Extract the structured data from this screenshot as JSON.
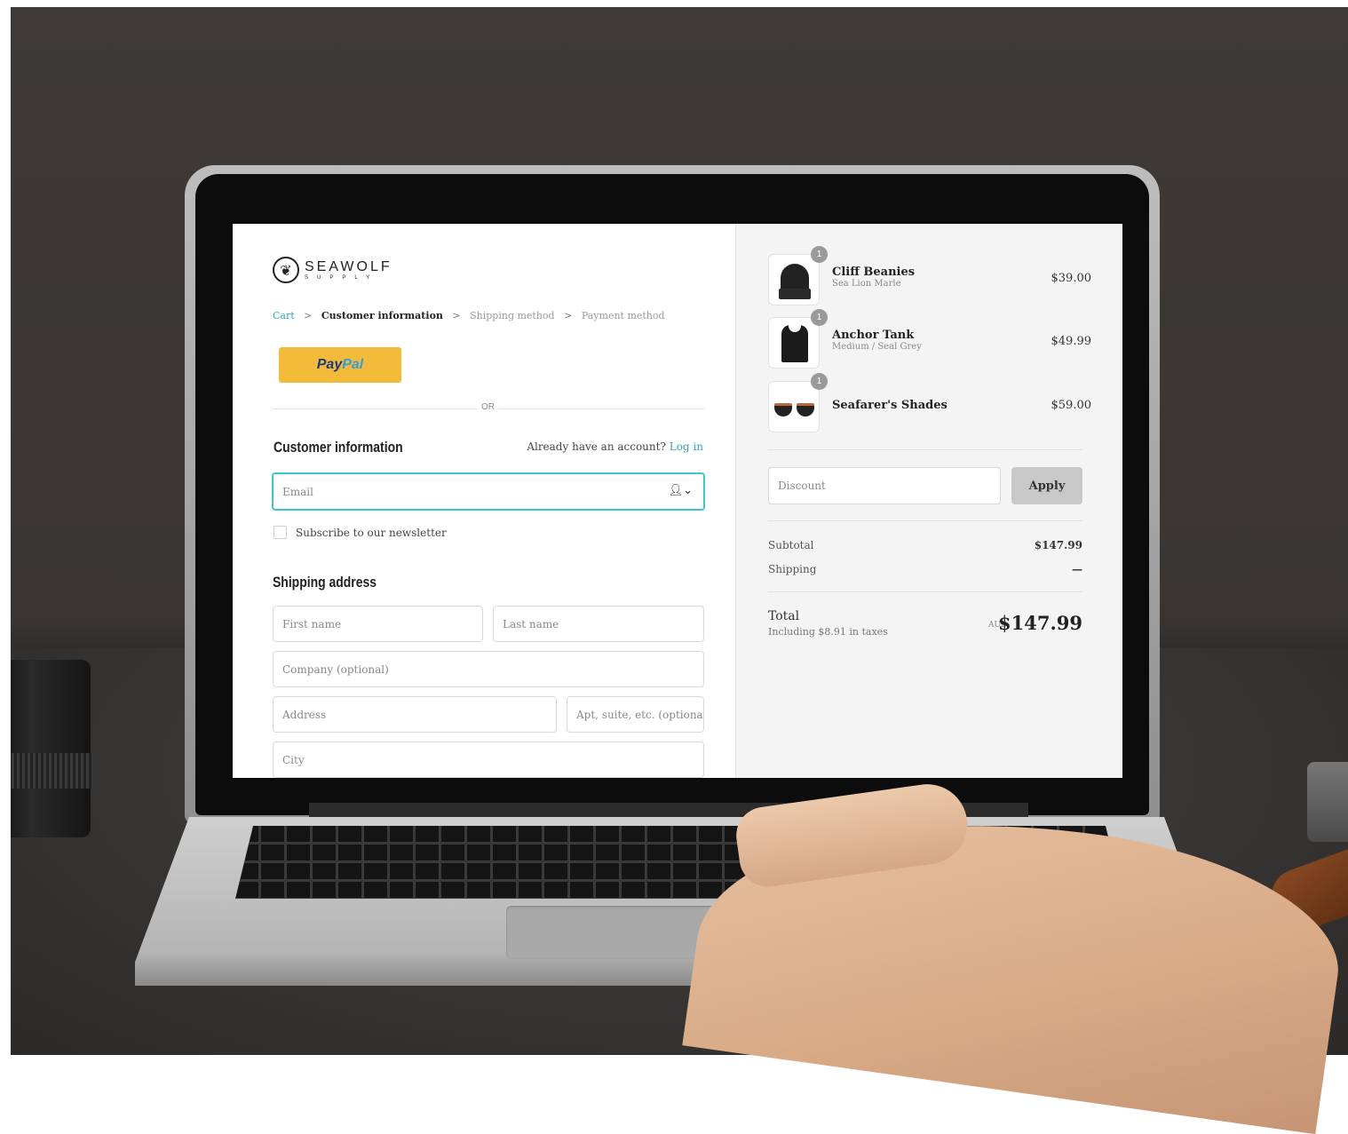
{
  "brand": {
    "name": "SEAWOLF",
    "sub": "SUPPLY"
  },
  "breadcrumb": {
    "cart": "Cart",
    "customer_information": "Customer information",
    "shipping_method": "Shipping method",
    "payment_method": "Payment method",
    "separator": ">"
  },
  "paypal": {
    "part1": "Pay",
    "part2": "Pal"
  },
  "or_label": "OR",
  "customer": {
    "title": "Customer information",
    "account_prompt": "Already have an account?",
    "login_link": "Log in",
    "email_placeholder": "Email",
    "newsletter_label": "Subscribe to our newsletter"
  },
  "shipping": {
    "title": "Shipping address",
    "first_name_placeholder": "First name",
    "last_name_placeholder": "Last name",
    "company_placeholder": "Company (optional)",
    "address_placeholder": "Address",
    "apt_placeholder": "Apt, suite, etc. (optiona",
    "city_placeholder": "City"
  },
  "cart_items": [
    {
      "name": "Cliff Beanies",
      "variant": "Sea Lion Marle",
      "price": "$39.00",
      "quantity": "1"
    },
    {
      "name": "Anchor Tank",
      "variant": "Medium / Seal Grey",
      "price": "$49.99",
      "quantity": "1"
    },
    {
      "name": "Seafarer's Shades",
      "variant": "",
      "price": "$59.00",
      "quantity": "1"
    }
  ],
  "discount": {
    "placeholder": "Discount",
    "apply_label": "Apply"
  },
  "summary": {
    "subtotal_label": "Subtotal",
    "subtotal_value": "$147.99",
    "shipping_label": "Shipping",
    "shipping_value": "—",
    "total_label": "Total",
    "taxes_note": "Including $8.91 in taxes",
    "currency": "AUD",
    "total_value": "$147.99"
  },
  "colors": {
    "accent": "#3cc7cf",
    "link": "#2fa6b9",
    "paypal_yellow": "#f4bb3b",
    "paypal_blue_dark": "#1b3a7a",
    "paypal_blue_light": "#2ba0dc"
  }
}
